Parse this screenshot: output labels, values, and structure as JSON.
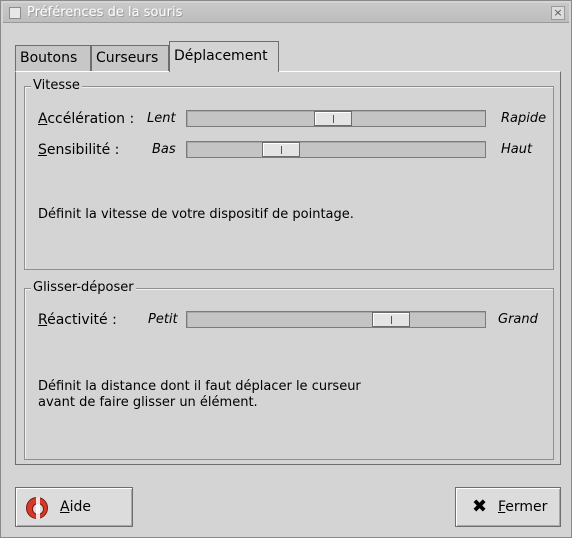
{
  "window": {
    "title": "Préférences de la souris",
    "close_glyph": "×"
  },
  "tabs": [
    {
      "label": "Boutons",
      "active": false
    },
    {
      "label": "Curseurs",
      "active": false
    },
    {
      "label": "Déplacement",
      "active": true
    }
  ],
  "speed": {
    "frame_label": "Vitesse",
    "acceleration": {
      "mnemonic": "A",
      "rest": "ccélération :",
      "min_label": "Lent",
      "max_label": "Rapide",
      "value_fraction": 0.49
    },
    "sensitivity": {
      "mnemonic": "S",
      "rest": "ensibilité :",
      "min_label": "Bas",
      "max_label": "Haut",
      "value_fraction": 0.29
    },
    "description": "Définit la vitesse de votre dispositif de pointage."
  },
  "drag_drop": {
    "frame_label": "Glisser-déposer",
    "reactivity": {
      "mnemonic": "R",
      "rest": "éactivité :",
      "min_label": "Petit",
      "max_label": "Grand",
      "value_fraction": 0.71
    },
    "description_line1": "Définit la distance dont il faut déplacer le curseur",
    "description_line2": "avant de faire glisser un élément."
  },
  "buttons": {
    "help": {
      "mnemonic": "A",
      "rest": "ide",
      "icon": "lifebuoy-icon"
    },
    "close": {
      "mnemonic": "F",
      "rest": "ermer",
      "icon": "x-icon"
    }
  },
  "colors": {
    "background": "#d4d4d4",
    "help_icon": "#d63a2a"
  }
}
